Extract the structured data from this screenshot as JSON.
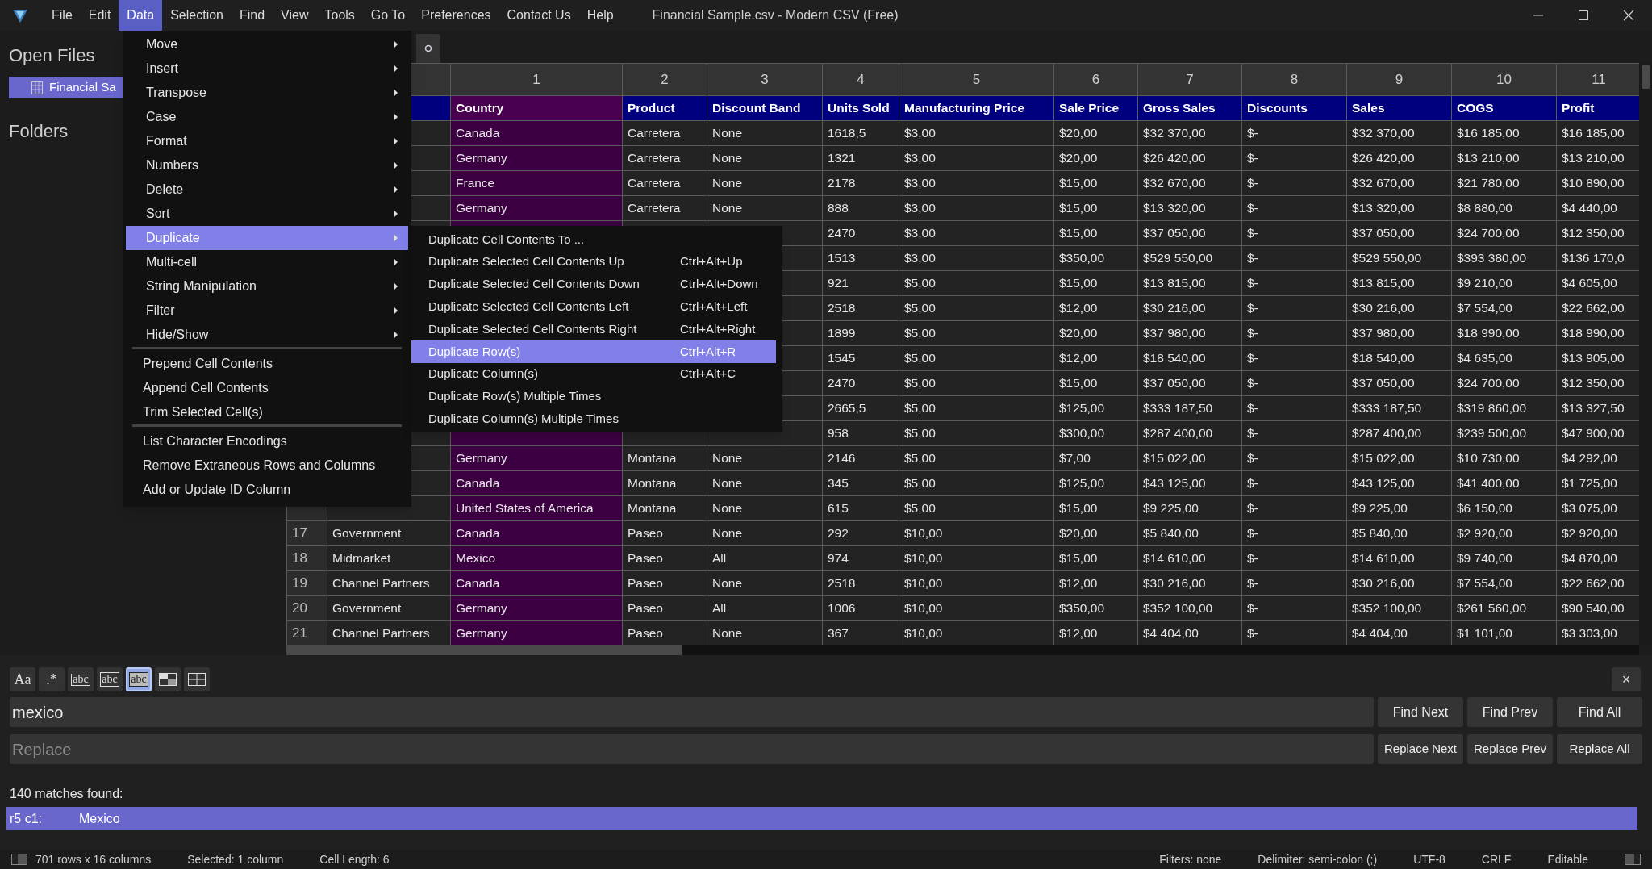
{
  "menu_bar": {
    "items": [
      {
        "label": "File",
        "selected": false
      },
      {
        "label": "Edit",
        "selected": false
      },
      {
        "label": "Data",
        "selected": true
      },
      {
        "label": "Selection",
        "selected": false
      },
      {
        "label": "Find",
        "selected": false
      },
      {
        "label": "View",
        "selected": false
      },
      {
        "label": "Tools",
        "selected": false
      },
      {
        "label": "Go To",
        "selected": false
      },
      {
        "label": "Preferences",
        "selected": false
      },
      {
        "label": "Contact Us",
        "selected": false
      },
      {
        "label": "Help",
        "selected": false
      }
    ]
  },
  "window": {
    "title": "Financial Sample.csv - Modern CSV (Free)"
  },
  "sidebar": {
    "open_files_title": "Open Files",
    "files": [
      {
        "label": "Financial Sa",
        "selected": true
      }
    ],
    "folders_title": "Folders"
  },
  "table": {
    "columns": [
      {
        "selected": false
      },
      {
        "number": "1",
        "name": "Country",
        "selected": true
      },
      {
        "number": "2",
        "name": "Product",
        "selected": false
      },
      {
        "number": "3",
        "name": "Discount Band",
        "selected": false
      },
      {
        "number": "4",
        "name": "Units Sold",
        "selected": false
      },
      {
        "number": "5",
        "name": "Manufacturing Price",
        "selected": false
      },
      {
        "number": "6",
        "name": "Sale Price",
        "selected": false
      },
      {
        "number": "7",
        "name": "Gross Sales",
        "selected": false
      },
      {
        "number": "8",
        "name": "Discounts",
        "selected": false
      },
      {
        "number": "9",
        "name": "Sales",
        "selected": false
      },
      {
        "number": "10",
        "name": "COGS",
        "selected": false
      },
      {
        "number": "11",
        "name": "Profit",
        "selected": false
      }
    ],
    "rows": [
      {
        "cells": [
          null,
          "Canada",
          "Carretera",
          "None",
          "1618,5",
          "$3,00",
          "$20,00",
          "$32 370,00",
          "$-",
          "$32 370,00",
          "$16 185,00",
          "$16 185,00"
        ]
      },
      {
        "cells": [
          null,
          "Germany",
          "Carretera",
          "None",
          "1321",
          "$3,00",
          "$20,00",
          "$26 420,00",
          "$-",
          "$26 420,00",
          "$13 210,00",
          "$13 210,00"
        ]
      },
      {
        "cells": [
          null,
          "France",
          "Carretera",
          "None",
          "2178",
          "$3,00",
          "$15,00",
          "$32 670,00",
          "$-",
          "$32 670,00",
          "$21 780,00",
          "$10 890,00"
        ]
      },
      {
        "cells": [
          null,
          "Germany",
          "Carretera",
          "None",
          "888",
          "$3,00",
          "$15,00",
          "$13 320,00",
          "$-",
          "$13 320,00",
          "$8 880,00",
          "$4 440,00"
        ]
      },
      {
        "cells": [
          null,
          null,
          null,
          null,
          "2470",
          "$3,00",
          "$15,00",
          "$37 050,00",
          "$-",
          "$37 050,00",
          "$24 700,00",
          "$12 350,00"
        ]
      },
      {
        "cells": [
          null,
          null,
          null,
          null,
          "1513",
          "$3,00",
          "$350,00",
          "$529 550,00",
          "$-",
          "$529 550,00",
          "$393 380,00",
          "$136 170,0"
        ]
      },
      {
        "cells": [
          null,
          null,
          null,
          null,
          "921",
          "$5,00",
          "$15,00",
          "$13 815,00",
          "$-",
          "$13 815,00",
          "$9 210,00",
          "$4 605,00"
        ]
      },
      {
        "cells": [
          null,
          null,
          null,
          null,
          "2518",
          "$5,00",
          "$12,00",
          "$30 216,00",
          "$-",
          "$30 216,00",
          "$7 554,00",
          "$22 662,00"
        ]
      },
      {
        "cells": [
          null,
          null,
          null,
          null,
          "1899",
          "$5,00",
          "$20,00",
          "$37 980,00",
          "$-",
          "$37 980,00",
          "$18 990,00",
          "$18 990,00"
        ]
      },
      {
        "cells": [
          null,
          null,
          null,
          null,
          "1545",
          "$5,00",
          "$12,00",
          "$18 540,00",
          "$-",
          "$18 540,00",
          "$4 635,00",
          "$13 905,00"
        ]
      },
      {
        "cells": [
          null,
          null,
          null,
          null,
          "2470",
          "$5,00",
          "$15,00",
          "$37 050,00",
          "$-",
          "$37 050,00",
          "$24 700,00",
          "$12 350,00"
        ]
      },
      {
        "cells": [
          null,
          null,
          null,
          null,
          "2665,5",
          "$5,00",
          "$125,00",
          "$333 187,50",
          "$-",
          "$333 187,50",
          "$319 860,00",
          "$13 327,50"
        ]
      },
      {
        "cells": [
          null,
          null,
          null,
          null,
          "958",
          "$5,00",
          "$300,00",
          "$287 400,00",
          "$-",
          "$287 400,00",
          "$239 500,00",
          "$47 900,00"
        ]
      },
      {
        "cells": [
          null,
          "Germany",
          "Montana",
          "None",
          "2146",
          "$5,00",
          "$7,00",
          "$15 022,00",
          "$-",
          "$15 022,00",
          "$10 730,00",
          "$4 292,00"
        ]
      },
      {
        "cells": [
          null,
          "Canada",
          "Montana",
          "None",
          "345",
          "$5,00",
          "$125,00",
          "$43 125,00",
          "$-",
          "$43 125,00",
          "$41 400,00",
          "$1 725,00"
        ]
      },
      {
        "cells": [
          null,
          "United States of America",
          "Montana",
          "None",
          "615",
          "$5,00",
          "$15,00",
          "$9 225,00",
          "$-",
          "$9 225,00",
          "$6 150,00",
          "$3 075,00"
        ]
      },
      {
        "number": "17",
        "cells": [
          "Government",
          "Canada",
          "Paseo",
          "None",
          "292",
          "$10,00",
          "$20,00",
          "$5 840,00",
          "$-",
          "$5 840,00",
          "$2 920,00",
          "$2 920,00"
        ]
      },
      {
        "number": "18",
        "cells": [
          "Midmarket",
          "Mexico",
          "Paseo",
          "All",
          "974",
          "$10,00",
          "$15,00",
          "$14 610,00",
          "$-",
          "$14 610,00",
          "$9 740,00",
          "$4 870,00"
        ]
      },
      {
        "number": "19",
        "cells": [
          "Channel Partners",
          "Canada",
          "Paseo",
          "None",
          "2518",
          "$10,00",
          "$12,00",
          "$30 216,00",
          "$-",
          "$30 216,00",
          "$7 554,00",
          "$22 662,00"
        ]
      },
      {
        "number": "20",
        "cells": [
          "Government",
          "Germany",
          "Paseo",
          "All",
          "1006",
          "$10,00",
          "$350,00",
          "$352 100,00",
          "$-",
          "$352 100,00",
          "$261 560,00",
          "$90 540,00"
        ]
      },
      {
        "number": "21",
        "cells": [
          "Channel Partners",
          "Germany",
          "Paseo",
          "None",
          "367",
          "$10,00",
          "$12,00",
          "$4 404,00",
          "$-",
          "$4 404,00",
          "$1 101,00",
          "$3 303,00"
        ]
      }
    ]
  },
  "data_menu": {
    "groups": [
      [
        {
          "label": "Move",
          "has_submenu": true,
          "selected": false
        },
        {
          "label": "Insert",
          "has_submenu": true,
          "selected": false
        },
        {
          "label": "Transpose",
          "has_submenu": true,
          "selected": false
        },
        {
          "label": "Case",
          "has_submenu": true,
          "selected": false
        },
        {
          "label": "Format",
          "has_submenu": true,
          "selected": false
        },
        {
          "label": "Numbers",
          "has_submenu": true,
          "selected": false
        },
        {
          "label": "Delete",
          "has_submenu": true,
          "selected": false
        },
        {
          "label": "Sort",
          "has_submenu": true,
          "selected": false
        },
        {
          "label": "Duplicate",
          "has_submenu": true,
          "selected": true
        },
        {
          "label": "Multi-cell",
          "has_submenu": true,
          "selected": false
        },
        {
          "label": "String Manipulation",
          "has_submenu": true,
          "selected": false
        },
        {
          "label": "Filter",
          "has_submenu": true,
          "selected": false
        },
        {
          "label": "Hide/Show",
          "has_submenu": true,
          "selected": false
        }
      ],
      [
        {
          "label": "Prepend Cell Contents",
          "has_submenu": false,
          "selected": false
        },
        {
          "label": "Append Cell Contents",
          "has_submenu": false,
          "selected": false
        },
        {
          "label": "Trim Selected Cell(s)",
          "has_submenu": false,
          "selected": false
        }
      ],
      [
        {
          "label": "List Character Encodings",
          "has_submenu": false,
          "selected": false
        },
        {
          "label": "Remove Extraneous Rows and Columns",
          "has_submenu": false,
          "selected": false
        },
        {
          "label": "Add or Update ID Column",
          "has_submenu": false,
          "selected": false
        }
      ]
    ]
  },
  "duplicate_submenu": {
    "items": [
      {
        "label": "Duplicate Cell Contents To ...",
        "selected": false
      },
      {
        "label": "Duplicate Selected Cell Contents Up",
        "shortcut": "Ctrl+Alt+Up",
        "selected": false
      },
      {
        "label": "Duplicate Selected Cell Contents Down",
        "shortcut": "Ctrl+Alt+Down",
        "selected": false
      },
      {
        "label": "Duplicate Selected Cell Contents Left",
        "shortcut": "Ctrl+Alt+Left",
        "selected": false
      },
      {
        "label": "Duplicate Selected Cell Contents Right",
        "shortcut": "Ctrl+Alt+Right",
        "selected": false
      },
      {
        "label": "Duplicate Row(s)",
        "shortcut": "Ctrl+Alt+R",
        "selected": true
      },
      {
        "label": "Duplicate Column(s)",
        "shortcut": "Ctrl+Alt+C",
        "selected": false
      },
      {
        "label": "Duplicate Row(s) Multiple Times",
        "selected": false
      },
      {
        "label": "Duplicate Column(s) Multiple Times",
        "selected": false
      }
    ]
  },
  "find_panel": {
    "toggles": [
      {
        "kind": "plain",
        "label": "Aa",
        "selected": false
      },
      {
        "kind": "plain",
        "label": ".*",
        "selected": false
      },
      {
        "kind": "bracket",
        "label": "abc",
        "selected": false
      },
      {
        "kind": "boxed",
        "label": "abc",
        "selected": false
      },
      {
        "kind": "boxed",
        "label": "abc",
        "selected": true
      },
      {
        "kind": "grid",
        "selected": false
      },
      {
        "kind": "cells",
        "selected": false
      }
    ],
    "close": "×",
    "find_value": "mexico",
    "replace_placeholder": "Replace",
    "find_buttons": [
      "Find Next",
      "Find Prev",
      "Find All"
    ],
    "replace_buttons": [
      "Replace Next",
      "Replace Prev",
      "Replace All"
    ],
    "match_count": "140 matches found:",
    "results": [
      {
        "location": "r5 c1:",
        "value": "Mexico",
        "selected": true
      }
    ]
  },
  "status_bar": {
    "left": [
      "701 rows x 16 columns",
      "Selected: 1 column",
      "Cell Length: 6"
    ],
    "right": [
      "Filters: none",
      "Delimiter: semi-colon (;)",
      "UTF-8",
      "CRLF",
      "Editable"
    ]
  }
}
